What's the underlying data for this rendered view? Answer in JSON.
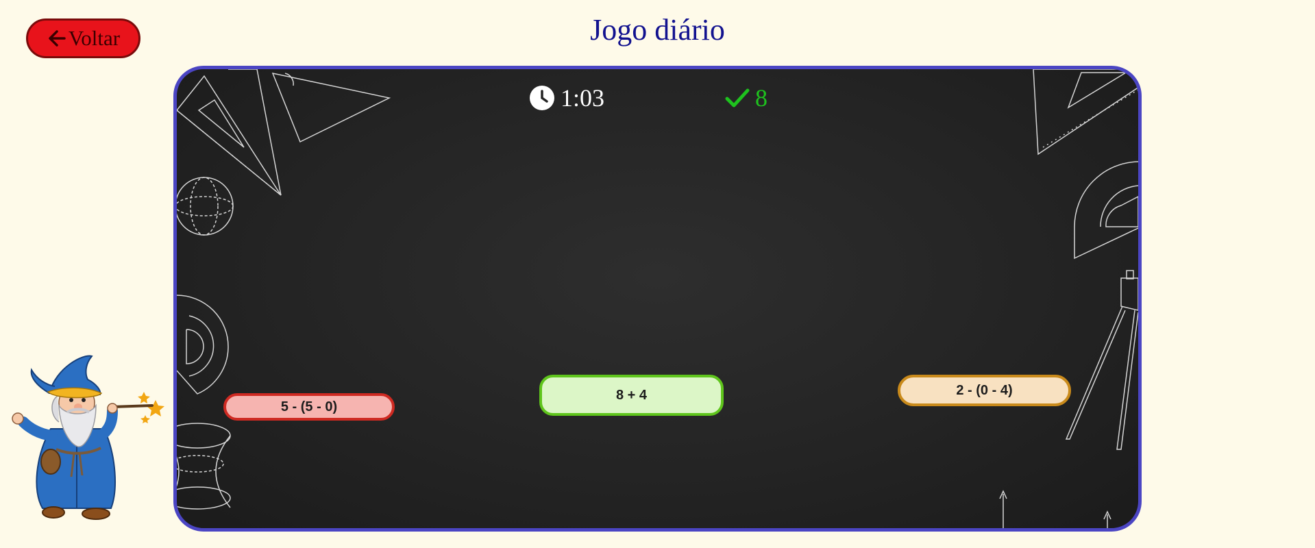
{
  "header": {
    "back_label": "Voltar",
    "title": "Jogo diário"
  },
  "hud": {
    "timer": "1:03",
    "score": "8"
  },
  "options": [
    {
      "expression": "5 - (5 - 0)",
      "color": "#cf2a22"
    },
    {
      "expression": "8 + 4",
      "color": "#5fc51c"
    },
    {
      "expression": "2 - (0 - 4)",
      "color": "#c98a1b"
    }
  ],
  "icons": {
    "back": "arrow-left-icon",
    "timer": "clock-icon",
    "score": "checkmark-icon",
    "mascot": "wizard-mascot"
  },
  "colors": {
    "background": "#fefae9",
    "title": "#12128f",
    "back_button": "#e8131b",
    "board_border": "#4b45c3",
    "score": "#1ec21e"
  }
}
